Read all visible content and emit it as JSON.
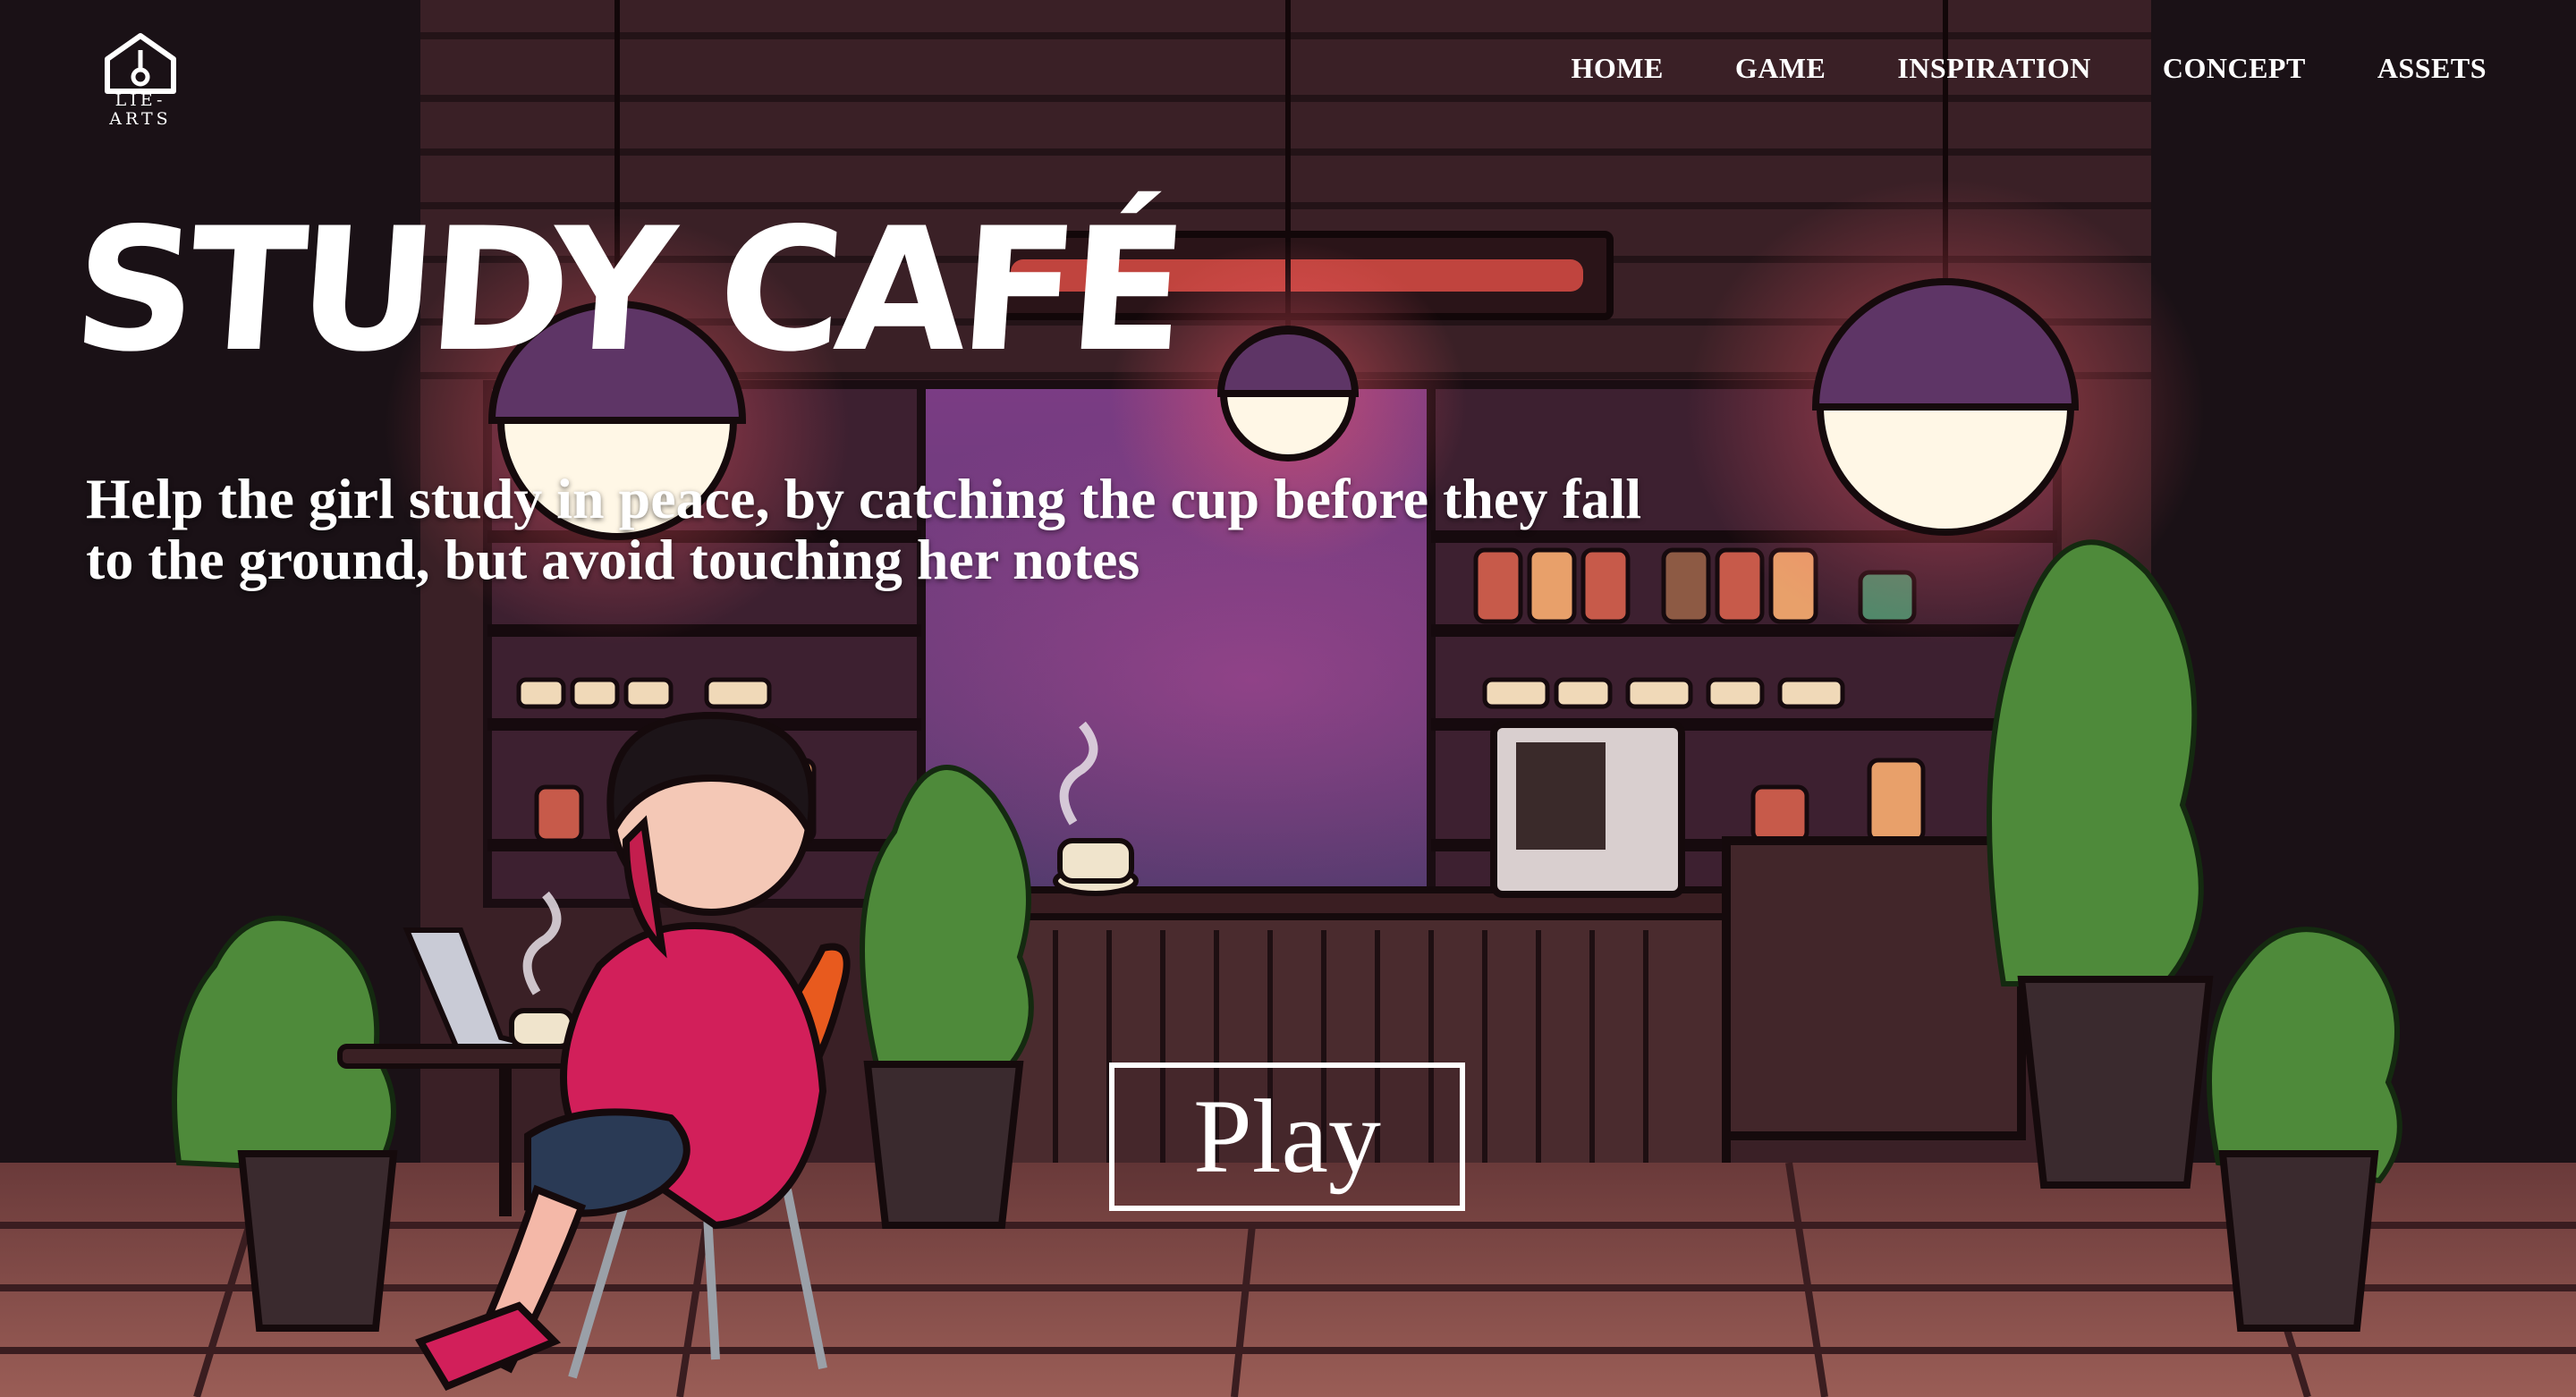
{
  "logo": {
    "text": "LIE-\nARTS",
    "icon": "house-pendant-icon"
  },
  "nav": {
    "items": [
      {
        "label": "HOME"
      },
      {
        "label": "GAME"
      },
      {
        "label": "INSPIRATION"
      },
      {
        "label": "CONCEPT"
      },
      {
        "label": "ASSETS"
      }
    ]
  },
  "hero": {
    "title": "STUDY CAFÉ",
    "subtitle_line1": "Help the girl study in peace, by catching the cup before they fall",
    "subtitle_line2": "to the ground, but avoid touching her notes",
    "play_label": "Play"
  },
  "colors": {
    "background_dark": "#1a1116",
    "text": "#ffffff",
    "lamp_shade": "#5e3566",
    "lamp_glow": "#fff7e6",
    "wood": "#4a2b2e",
    "plant": "#4e8a3a",
    "girl_sweater": "#d21f5a",
    "chair": "#e85a1e"
  }
}
